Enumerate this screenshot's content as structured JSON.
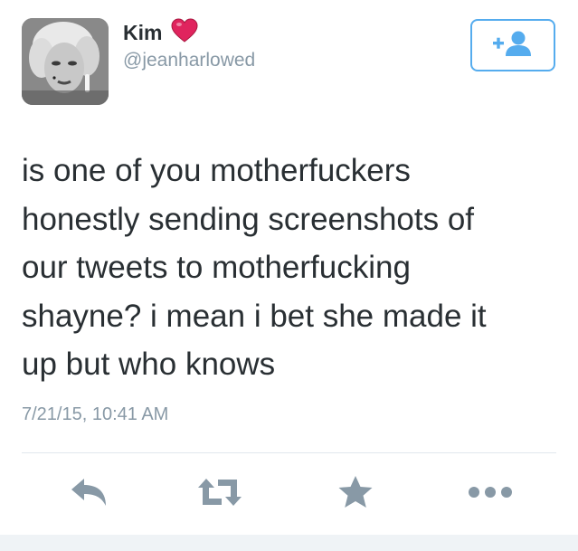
{
  "user": {
    "display_name": "Kim",
    "handle": "@jeanharlowed",
    "name_emoji": "heart-icon"
  },
  "follow_button": {
    "icon": "add-person-icon"
  },
  "tweet": {
    "text": "is one of you motherfuckers\nhonestly sending screenshots of\nour tweets to motherfucking\nshayne? i mean i bet she made it\nup but who knows",
    "timestamp": "7/21/15, 10:41 AM"
  },
  "actions": [
    {
      "icon": "reply-icon"
    },
    {
      "icon": "retweet-icon"
    },
    {
      "icon": "favorite-star-icon"
    },
    {
      "icon": "more-dots-icon"
    }
  ],
  "colors": {
    "accent": "#55acee",
    "text": "#292f33",
    "muted": "#8899a6",
    "action_icons": "#8899a6",
    "heart": "#e0245e"
  }
}
